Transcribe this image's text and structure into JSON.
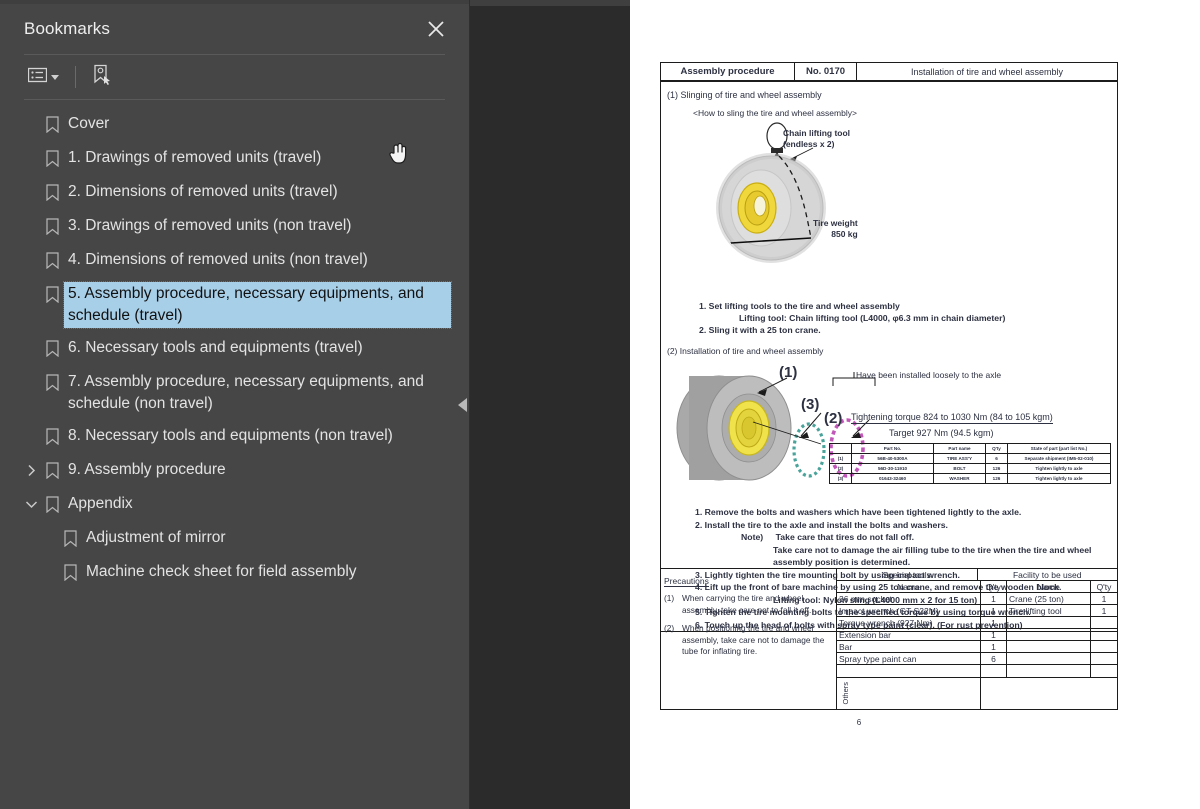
{
  "panel": {
    "title": "Bookmarks",
    "close_icon": "close-icon",
    "toolbar": {
      "options_icon": "list-options-icon",
      "options_caret": "chevron-down-icon",
      "new_bookmark_icon": "new-bookmark-icon"
    },
    "collapse_icon": "collapse-left-icon",
    "items": [
      {
        "label": "Cover",
        "indent": 0,
        "twisty": "none",
        "selected": false
      },
      {
        "label": "1. Drawings of removed units (travel)",
        "indent": 0,
        "twisty": "none",
        "selected": false
      },
      {
        "label": "2. Dimensions of removed units (travel)",
        "indent": 0,
        "twisty": "none",
        "selected": false
      },
      {
        "label": "3. Drawings of removed units (non travel)",
        "indent": 0,
        "twisty": "none",
        "selected": false
      },
      {
        "label": "4. Dimensions of removed units (non travel)",
        "indent": 0,
        "twisty": "none",
        "selected": false
      },
      {
        "label": "5. Assembly procedure, necessary equipments, and schedule (travel)",
        "indent": 0,
        "twisty": "none",
        "selected": true
      },
      {
        "label": "6. Necessary tools and equipments (travel)",
        "indent": 0,
        "twisty": "none",
        "selected": false
      },
      {
        "label": "7. Assembly procedure, necessary equipments, and schedule (non travel)",
        "indent": 0,
        "twisty": "none",
        "selected": false
      },
      {
        "label": "8. Necessary tools and equipments (non travel)",
        "indent": 0,
        "twisty": "none",
        "selected": false
      },
      {
        "label": "9. Assembly procedure",
        "indent": 0,
        "twisty": "collapsed",
        "selected": false
      },
      {
        "label": "Appendix",
        "indent": 0,
        "twisty": "expanded",
        "selected": false
      },
      {
        "label": "Adjustment of mirror",
        "indent": 1,
        "twisty": "none",
        "selected": false
      },
      {
        "label": "Machine check sheet for field assembly",
        "indent": 1,
        "twisty": "none",
        "selected": false
      }
    ]
  },
  "document": {
    "header": {
      "col1": "Assembly procedure",
      "col2": "No. 0170",
      "col3": "Installation of tire and wheel assembly"
    },
    "section1": {
      "title": "(1)  Slinging of tire and wheel assembly",
      "subtitle": "<How to sling the tire and wheel assembly>",
      "chain_label_l1": "Chain lifting tool",
      "chain_label_l2": "(endless x 2)",
      "tire_weight_l1": "Tire weight",
      "tire_weight_l2": "850 kg",
      "step1": "1. Set lifting tools to the tire and wheel assembly",
      "step1_sub": "Lifting tool: Chain lifting tool (L4000, φ6.3 mm in chain diameter)",
      "step2": "2. Sling it with a 25 ton crane."
    },
    "section2": {
      "title": "(2)  Installation of tire and wheel assembly",
      "callout1": "(1)",
      "callout2": "(2)",
      "callout3": "(3)",
      "loose_note": "Have been installed loosely to the axle",
      "torque_line1": "Tightening torque 824 to 1030 Nm (84 to 105 kgm)",
      "torque_line2": "Target 927 Nm (94.5 kgm)",
      "parts_table": {
        "headers": [
          "",
          "Part No.",
          "Part name",
          "Q'ty",
          "State of part (part list No.)"
        ],
        "rows": [
          [
            "(1)",
            "56B-40-5300A",
            "TIRE ASS'Y",
            "6",
            "Separate shipment (IM5-02-010)"
          ],
          [
            "(2)",
            "56D-30-11910",
            "BOLT",
            "126",
            "Tighten lightly to axle"
          ],
          [
            "(3)",
            "01643-32460",
            "WASHER",
            "126",
            "Tighten lightly to axle"
          ]
        ]
      },
      "steps": [
        "1. Remove the bolts and washers which have been tightened lightly to the axle.",
        "2. Install the tire to the axle and install the bolts and washers."
      ],
      "note_label": "Note)",
      "note_line1": "Take care that tires do not fall off.",
      "note_line2": "Take care not to damage the air filling tube to the tire when the tire and wheel",
      "note_line3": "assembly position is determined.",
      "step3": "3. Lightly tighten the tire mounting bolt by using impact wrench.",
      "step4": "4. Lift up the front of bare machine by using 25 ton crane, and remove the wooden block.",
      "step4_sub": "Lifting tool: Nylon sling (L4000 mm x 2 for 15 ton)",
      "step5": "5. Tighten the tire mounting bolts to the specified torque by using torque wrench.",
      "step6": "6. Touch up the head of bolts with spray type paint (clear). (For rust prevention)"
    },
    "precautions": {
      "heading": "Precautions",
      "items": [
        {
          "num": "(1)",
          "text": "When carrying the tire and wheel assembly, take care not to fall it off."
        },
        {
          "num": "(2)",
          "text": "When positioning the tire and wheel assembly, take care not to damage the tube for inflating tire."
        }
      ]
    },
    "special_tools": {
      "group_heading": "Special tools",
      "name_header": "Name",
      "qty_header": "Q'ty",
      "rows": [
        {
          "name": "36 mm socket",
          "qty": "1"
        },
        {
          "name": "Impact wrench (GT-S22M)",
          "qty": "1"
        },
        {
          "name": "Torque wrench (927 Nm)",
          "qty": "1"
        },
        {
          "name": "Extension bar",
          "qty": "1"
        },
        {
          "name": "Bar",
          "qty": "1"
        },
        {
          "name": "Spray type paint can",
          "qty": "6"
        },
        {
          "name": "",
          "qty": ""
        }
      ]
    },
    "facility": {
      "group_heading": "Facility to be used",
      "name_header": "Name",
      "qty_header": "Q'ty",
      "rows": [
        {
          "name": "Crane (25 ton)",
          "qty": "1"
        },
        {
          "name": "Tire lifting tool",
          "qty": "1"
        },
        {
          "name": "",
          "qty": ""
        },
        {
          "name": "",
          "qty": ""
        },
        {
          "name": "",
          "qty": ""
        },
        {
          "name": "",
          "qty": ""
        },
        {
          "name": "",
          "qty": ""
        }
      ]
    },
    "others_label": "Others",
    "page_number": "6"
  },
  "colors": {
    "panel_bg": "#464646",
    "selection": "#a8cfe8",
    "viewer_bg": "#2b2b2b",
    "page_bg": "#ffffff",
    "doc_text": "#2d3142"
  }
}
